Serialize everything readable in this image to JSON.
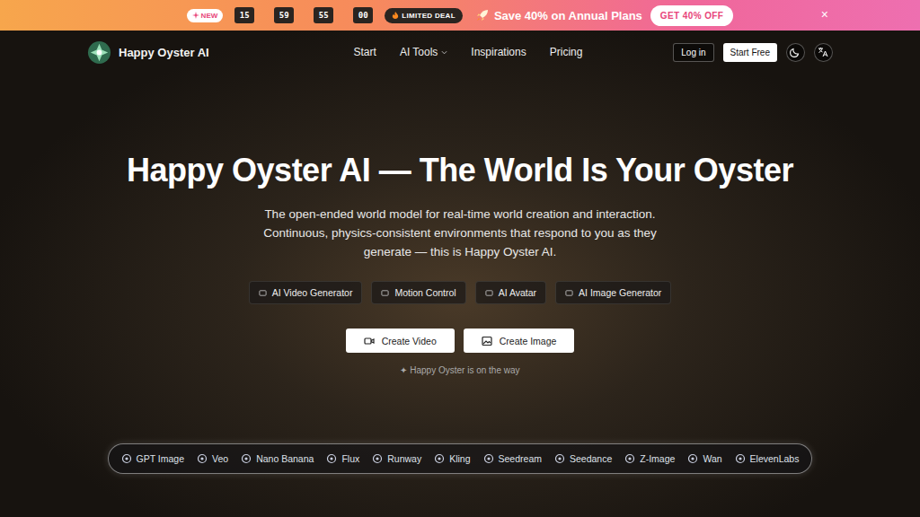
{
  "banner": {
    "new_badge": "NEW",
    "countdown": [
      "15",
      "59",
      "55",
      "00"
    ],
    "deal": "LIMITED DEAL",
    "promo": "Save 40% on Annual Plans",
    "cta": "GET 40% OFF",
    "close": "×"
  },
  "nav": {
    "brand": "Happy Oyster AI",
    "links": [
      {
        "label": "Start",
        "dropdown": false
      },
      {
        "label": "AI Tools",
        "dropdown": true
      },
      {
        "label": "Inspirations",
        "dropdown": false
      },
      {
        "label": "Pricing",
        "dropdown": false
      }
    ],
    "login": "Log in",
    "start_free": "Start Free"
  },
  "hero": {
    "title": "Happy Oyster AI — The World Is Your Oyster",
    "subtitle": [
      "The open-ended world model for real-time world creation and interaction.",
      "Continuous, physics-consistent environments that respond to you as they",
      "generate — this is Happy Oyster AI."
    ],
    "chips": [
      "AI Video Generator",
      "Motion Control",
      "AI Avatar",
      "AI Image Generator"
    ],
    "buttons": [
      "Create Video",
      "Create Image"
    ],
    "note": "✦ Happy Oyster is on the way"
  },
  "models": [
    "GPT Image",
    "Veo",
    "Nano Banana",
    "Flux",
    "Runway",
    "Kling",
    "Seedream",
    "Seedance",
    "Z-Image",
    "Wan",
    "ElevenLabs"
  ]
}
